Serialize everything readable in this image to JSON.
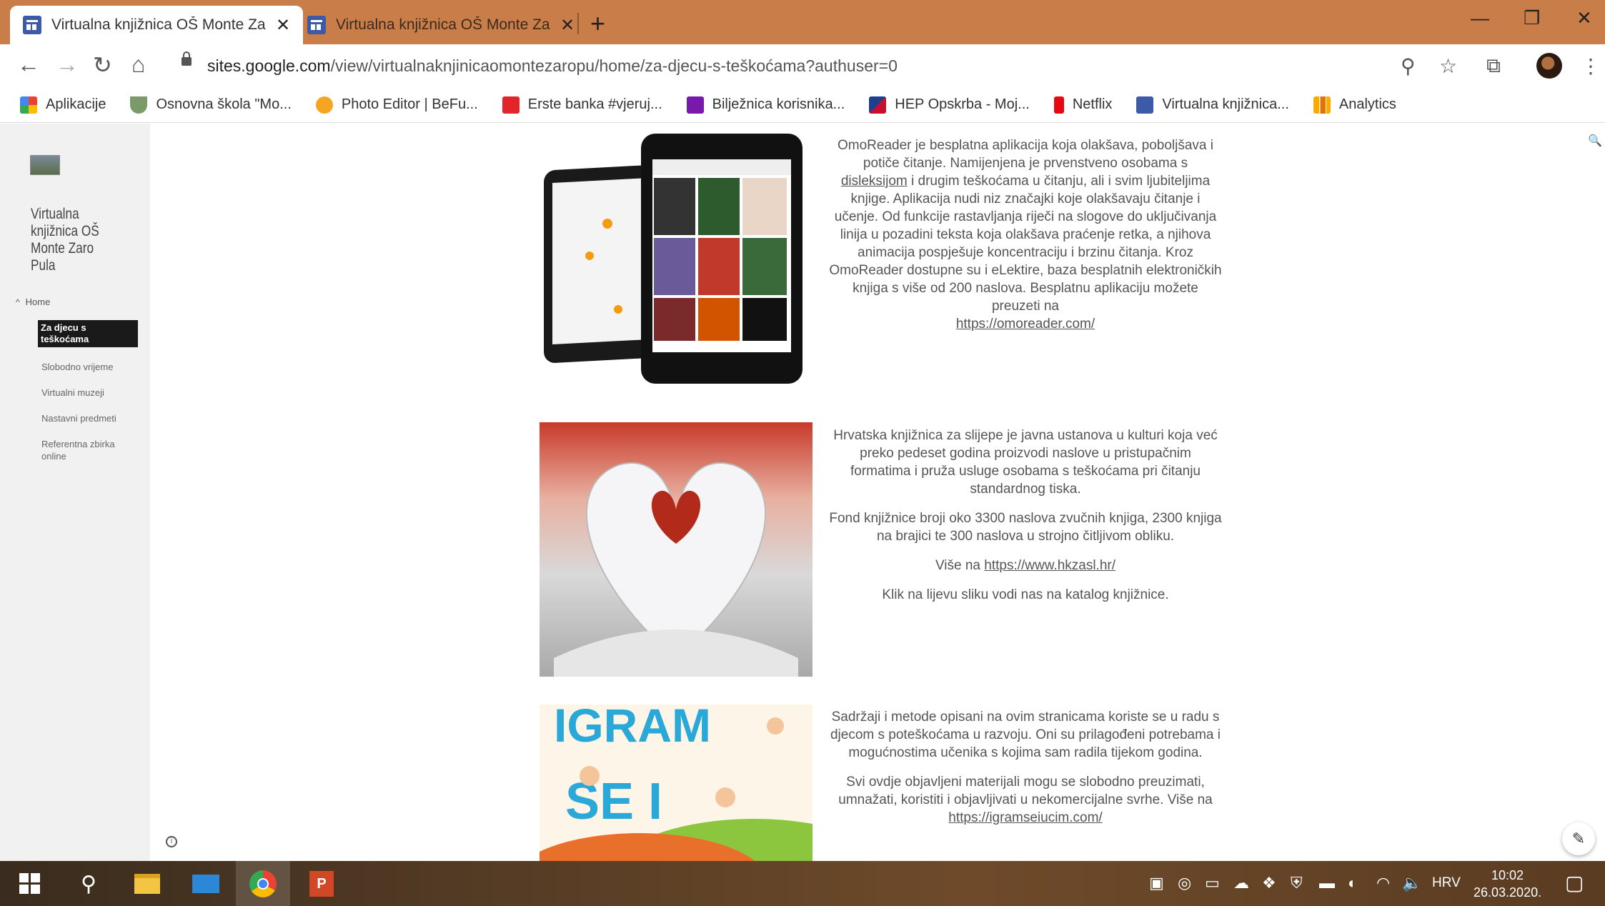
{
  "browser": {
    "tabs": [
      {
        "title": "Virtualna knjižnica OŠ Monte Zaro",
        "active": true
      },
      {
        "title": "Virtualna knjižnica OŠ Monte Zaro",
        "active": false
      }
    ],
    "url_host": "sites.google.com",
    "url_path": "/view/virtualnaknjinicaomontezaropu/home/za-djecu-s-teškoćama?authuser=0",
    "bookmarks": [
      {
        "label": "Aplikacije",
        "icon": "apps-grid-icon",
        "color": "#e94235"
      },
      {
        "label": "Osnovna škola \"Mo...",
        "icon": "shield-icon",
        "color": "#7a9a6a"
      },
      {
        "label": "Photo Editor | BeFu...",
        "icon": "befunky-icon",
        "color": "#f4a623"
      },
      {
        "label": "Erste banka #vjeruj...",
        "icon": "erste-icon",
        "color": "#e3242b"
      },
      {
        "label": "Bilježnica korisnika...",
        "icon": "onenote-icon",
        "color": "#7719aa"
      },
      {
        "label": "HEP Opskrba - Moj...",
        "icon": "hep-icon",
        "color": "#c8102e"
      },
      {
        "label": "Netflix",
        "icon": "netflix-icon",
        "color": "#e50914"
      },
      {
        "label": "Virtualna knjižnica...",
        "icon": "google-sites-icon",
        "color": "#3c5aa8"
      },
      {
        "label": "Analytics",
        "icon": "analytics-icon",
        "color": "#f9ab00"
      }
    ]
  },
  "sidebar": {
    "site_title": "Virtualna knjižnica OŠ Monte Zaro Pula",
    "home_label": "Home",
    "active_label": "Za djecu s teškoćama",
    "items": [
      {
        "label": "Slobodno vrijeme"
      },
      {
        "label": "Virtualni muzeji"
      },
      {
        "label": "Nastavni predmeti"
      },
      {
        "label": "Referentna zbirka online"
      }
    ]
  },
  "content": {
    "omoreader": {
      "text_before": "OmoReader je besplatna aplikacija koja olakšava, poboljšava i potiče čitanje. Namijenjena je prvenstveno osobama s ",
      "link_dysl": "disleksijom",
      "text_after": " i drugim teškoćama u čitanju, ali i svim ljubiteljima knjige. Aplikacija nudi niz značajki koje olakšavaju čitanje i učenje. Od funkcije rastavljanja riječi na slogove do uključivanja linija u pozadini teksta koja olakšava praćenje retka, a njihova animacija pospješuje koncentraciju i brzinu čitanja. Kroz OmoReader dostupne su i eLektire, baza besplatnih elektroničkih knjiga s više od 200 naslova. Besplatnu aplikaciju možete preuzeti na",
      "link": "https://omoreader.com/"
    },
    "hkzasl": {
      "p1": "Hrvatska knjižnica za slijepe je javna ustanova u kulturi koja već preko pedeset godina proizvodi naslove u pristupačnim formatima i pruža usluge osobama s teškoćama pri čitanju standardnog tiska.",
      "p2": "Fond knjižnice broji oko 3300 naslova zvučnih knjiga, 2300 knjiga na brajici te 300 naslova u strojno čitljivom obliku.",
      "p3_prefix": "Više na ",
      "p3_link": "https://www.hkzasl.hr/",
      "p4": "Klik na lijevu sliku vodi nas na katalog knjižnice."
    },
    "igram": {
      "p1": "Sadržaji i metode opisani na ovim stranicama  koriste se u radu s djecom s poteškoćama u razvoju. Oni su prilagođeni potrebama i mogućnostima učenika s kojima sam radila tijekom godina.",
      "p2_prefix": "Svi  ovdje objavljeni materijali mogu se slobodno preuzimati, umnažati, koristiti i objavljivati u nekomercijalne svrhe. Više na ",
      "p2_link": "https://igramseiucim.com/",
      "banner_top": "IGRAM",
      "banner_bottom": "SE I"
    }
  },
  "taskbar": {
    "language": "HRV",
    "time": "10:02",
    "date": "26.03.2020."
  }
}
